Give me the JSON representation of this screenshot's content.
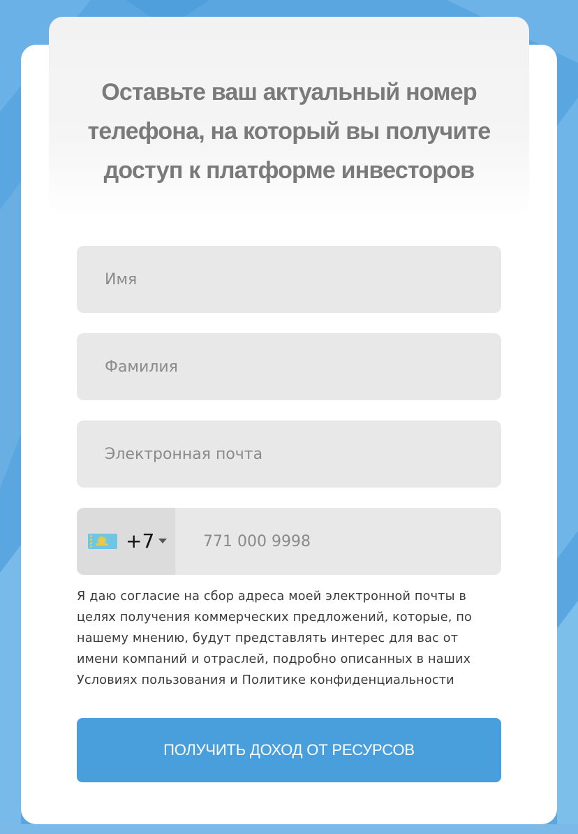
{
  "form": {
    "headline": "Оставьте ваш актуальный номер телефона, на который вы получите доступ к платформе инвесторов",
    "first_name": {
      "placeholder": "Имя",
      "value": ""
    },
    "last_name": {
      "placeholder": "Фамилия",
      "value": ""
    },
    "email": {
      "placeholder": "Электронная почта",
      "value": ""
    },
    "phone": {
      "country_flag": "kazakhstan-flag-icon",
      "dial_code": "+7",
      "dropdown_icon": "caret-down-icon",
      "placeholder": "771 000 9998",
      "value": ""
    },
    "consent_text": "Я даю согласие на сбор адреса моей электронной почты в целях получения коммерческих предложений, которые, по нашему мнению, будут представлять интерес для вас от имени компаний и отраслей, подробно описанных в наших Условиях пользования и Политике конфиденциальности",
    "submit_label": "ПОЛУЧИТЬ ДОХОД ОТ РЕСУРСОВ"
  },
  "colors": {
    "background": "#5aa6e0",
    "accent": "#489fdc",
    "field_background": "#e8e8e8",
    "headline_text": "#7a7a7a"
  }
}
